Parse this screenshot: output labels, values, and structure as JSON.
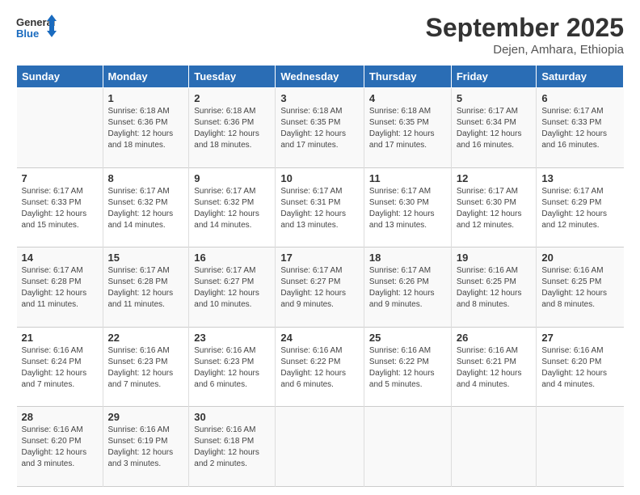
{
  "logo": {
    "line1": "General",
    "line2": "Blue"
  },
  "title": "September 2025",
  "subtitle": "Dejen, Amhara, Ethiopia",
  "days_of_week": [
    "Sunday",
    "Monday",
    "Tuesday",
    "Wednesday",
    "Thursday",
    "Friday",
    "Saturday"
  ],
  "weeks": [
    [
      {
        "day": "",
        "info": ""
      },
      {
        "day": "1",
        "info": "Sunrise: 6:18 AM\nSunset: 6:36 PM\nDaylight: 12 hours\nand 18 minutes."
      },
      {
        "day": "2",
        "info": "Sunrise: 6:18 AM\nSunset: 6:36 PM\nDaylight: 12 hours\nand 18 minutes."
      },
      {
        "day": "3",
        "info": "Sunrise: 6:18 AM\nSunset: 6:35 PM\nDaylight: 12 hours\nand 17 minutes."
      },
      {
        "day": "4",
        "info": "Sunrise: 6:18 AM\nSunset: 6:35 PM\nDaylight: 12 hours\nand 17 minutes."
      },
      {
        "day": "5",
        "info": "Sunrise: 6:17 AM\nSunset: 6:34 PM\nDaylight: 12 hours\nand 16 minutes."
      },
      {
        "day": "6",
        "info": "Sunrise: 6:17 AM\nSunset: 6:33 PM\nDaylight: 12 hours\nand 16 minutes."
      }
    ],
    [
      {
        "day": "7",
        "info": "Sunrise: 6:17 AM\nSunset: 6:33 PM\nDaylight: 12 hours\nand 15 minutes."
      },
      {
        "day": "8",
        "info": "Sunrise: 6:17 AM\nSunset: 6:32 PM\nDaylight: 12 hours\nand 14 minutes."
      },
      {
        "day": "9",
        "info": "Sunrise: 6:17 AM\nSunset: 6:32 PM\nDaylight: 12 hours\nand 14 minutes."
      },
      {
        "day": "10",
        "info": "Sunrise: 6:17 AM\nSunset: 6:31 PM\nDaylight: 12 hours\nand 13 minutes."
      },
      {
        "day": "11",
        "info": "Sunrise: 6:17 AM\nSunset: 6:30 PM\nDaylight: 12 hours\nand 13 minutes."
      },
      {
        "day": "12",
        "info": "Sunrise: 6:17 AM\nSunset: 6:30 PM\nDaylight: 12 hours\nand 12 minutes."
      },
      {
        "day": "13",
        "info": "Sunrise: 6:17 AM\nSunset: 6:29 PM\nDaylight: 12 hours\nand 12 minutes."
      }
    ],
    [
      {
        "day": "14",
        "info": "Sunrise: 6:17 AM\nSunset: 6:28 PM\nDaylight: 12 hours\nand 11 minutes."
      },
      {
        "day": "15",
        "info": "Sunrise: 6:17 AM\nSunset: 6:28 PM\nDaylight: 12 hours\nand 11 minutes."
      },
      {
        "day": "16",
        "info": "Sunrise: 6:17 AM\nSunset: 6:27 PM\nDaylight: 12 hours\nand 10 minutes."
      },
      {
        "day": "17",
        "info": "Sunrise: 6:17 AM\nSunset: 6:27 PM\nDaylight: 12 hours\nand 9 minutes."
      },
      {
        "day": "18",
        "info": "Sunrise: 6:17 AM\nSunset: 6:26 PM\nDaylight: 12 hours\nand 9 minutes."
      },
      {
        "day": "19",
        "info": "Sunrise: 6:16 AM\nSunset: 6:25 PM\nDaylight: 12 hours\nand 8 minutes."
      },
      {
        "day": "20",
        "info": "Sunrise: 6:16 AM\nSunset: 6:25 PM\nDaylight: 12 hours\nand 8 minutes."
      }
    ],
    [
      {
        "day": "21",
        "info": "Sunrise: 6:16 AM\nSunset: 6:24 PM\nDaylight: 12 hours\nand 7 minutes."
      },
      {
        "day": "22",
        "info": "Sunrise: 6:16 AM\nSunset: 6:23 PM\nDaylight: 12 hours\nand 7 minutes."
      },
      {
        "day": "23",
        "info": "Sunrise: 6:16 AM\nSunset: 6:23 PM\nDaylight: 12 hours\nand 6 minutes."
      },
      {
        "day": "24",
        "info": "Sunrise: 6:16 AM\nSunset: 6:22 PM\nDaylight: 12 hours\nand 6 minutes."
      },
      {
        "day": "25",
        "info": "Sunrise: 6:16 AM\nSunset: 6:22 PM\nDaylight: 12 hours\nand 5 minutes."
      },
      {
        "day": "26",
        "info": "Sunrise: 6:16 AM\nSunset: 6:21 PM\nDaylight: 12 hours\nand 4 minutes."
      },
      {
        "day": "27",
        "info": "Sunrise: 6:16 AM\nSunset: 6:20 PM\nDaylight: 12 hours\nand 4 minutes."
      }
    ],
    [
      {
        "day": "28",
        "info": "Sunrise: 6:16 AM\nSunset: 6:20 PM\nDaylight: 12 hours\nand 3 minutes."
      },
      {
        "day": "29",
        "info": "Sunrise: 6:16 AM\nSunset: 6:19 PM\nDaylight: 12 hours\nand 3 minutes."
      },
      {
        "day": "30",
        "info": "Sunrise: 6:16 AM\nSunset: 6:18 PM\nDaylight: 12 hours\nand 2 minutes."
      },
      {
        "day": "",
        "info": ""
      },
      {
        "day": "",
        "info": ""
      },
      {
        "day": "",
        "info": ""
      },
      {
        "day": "",
        "info": ""
      }
    ]
  ]
}
